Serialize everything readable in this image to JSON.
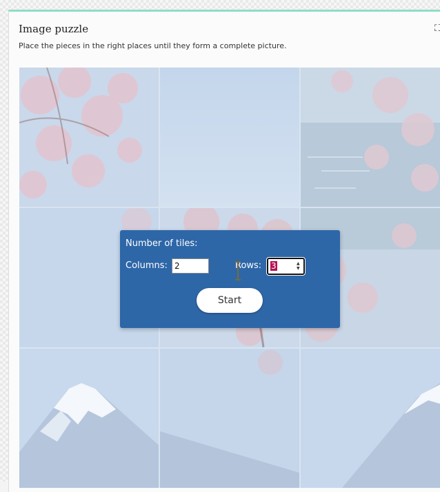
{
  "widget": {
    "title": "Image puzzle",
    "subtitle": "Place the pieces in the right places until they form a complete picture.",
    "expand_icon": "expand-icon"
  },
  "puzzle": {
    "tiles": [
      {
        "name": "tile-1",
        "scene": "cherry-blossom"
      },
      {
        "name": "tile-2",
        "scene": "sky"
      },
      {
        "name": "tile-3",
        "scene": "lake-blossom"
      },
      {
        "name": "tile-4",
        "scene": "sky-blossom"
      },
      {
        "name": "tile-5",
        "scene": "blossom-branch"
      },
      {
        "name": "tile-6",
        "scene": "lake-blossom-lower"
      },
      {
        "name": "tile-7",
        "scene": "mount-fuji"
      },
      {
        "name": "tile-8",
        "scene": "mountain-slope"
      },
      {
        "name": "tile-9",
        "scene": "mountain-peak"
      }
    ]
  },
  "settings": {
    "heading": "Number of tiles:",
    "columns_label": "Columns:",
    "columns_value": "2",
    "rows_label": "Rows:",
    "rows_value": "3",
    "start_label": "Start"
  },
  "colors": {
    "accent_bar": "#8fdcc7",
    "dialog_bg": "#2e67a8",
    "selection": "#b31153"
  }
}
